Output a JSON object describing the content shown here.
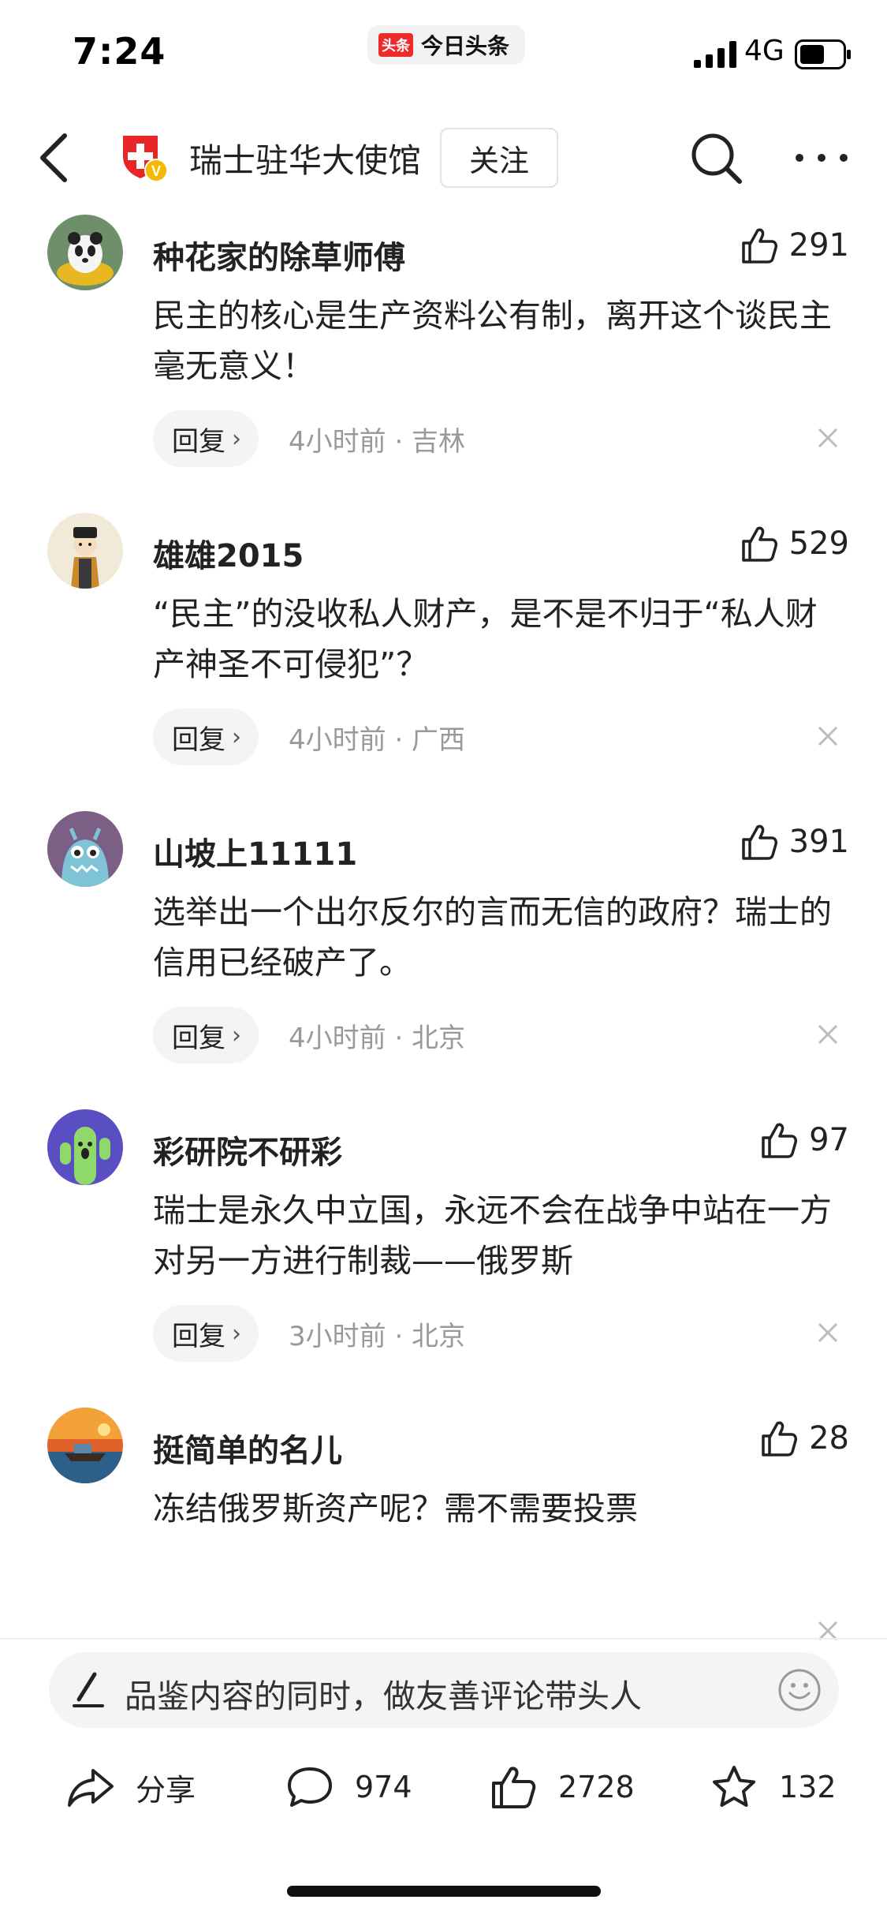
{
  "status_bar": {
    "time": "7:24",
    "app_badge": "头条",
    "app_name": "今日头条",
    "network": "4G"
  },
  "nav": {
    "account_name": "瑞士驻华大使馆",
    "follow_label": "关注",
    "verified_badge": "V"
  },
  "comments": [
    {
      "username": "种花家的除草师傅",
      "likes": "291",
      "text": "民主的核心是生产资料公有制，离开这个谈民主毫无意义！",
      "reply_label": "回复",
      "time_location": "4小时前 · 吉林",
      "avatar_icon": "panda-avatar"
    },
    {
      "username": "雄雄2015",
      "likes": "529",
      "text": "“民主”的没收私人财产，是不是不归于“私人财产神圣不可侵犯”？",
      "reply_label": "回复",
      "time_location": "4小时前 · 广西",
      "avatar_icon": "cartoon-official-avatar"
    },
    {
      "username": "山坡上11111",
      "likes": "391",
      "text": "选举出一个出尔反尔的言而无信的政府？瑞士的信用已经破产了。",
      "reply_label": "回复",
      "time_location": "4小时前 · 北京",
      "avatar_icon": "blue-monster-avatar"
    },
    {
      "username": "彩研院不研彩",
      "likes": "97",
      "text": "瑞士是永久中立国，永远不会在战争中站在一方对另一方进行制裁——俄罗斯",
      "reply_label": "回复",
      "time_location": "3小时前 · 北京",
      "avatar_icon": "cactus-avatar"
    },
    {
      "username": "挺简单的名儿",
      "likes": "28",
      "text": "冻结俄罗斯资产呢？需不需要投票",
      "reply_label": "",
      "time_location": "",
      "avatar_icon": "sunset-boat-avatar"
    }
  ],
  "input": {
    "placeholder": "品鉴内容的同时，做友善评论带头人"
  },
  "actions": {
    "share_label": "分享",
    "comments_count": "974",
    "likes_count": "2728",
    "favorites_count": "132"
  },
  "colors": {
    "accent_red": "#ee2b2b",
    "gray_text": "#999999",
    "chip_bg": "#f4f4f4"
  }
}
